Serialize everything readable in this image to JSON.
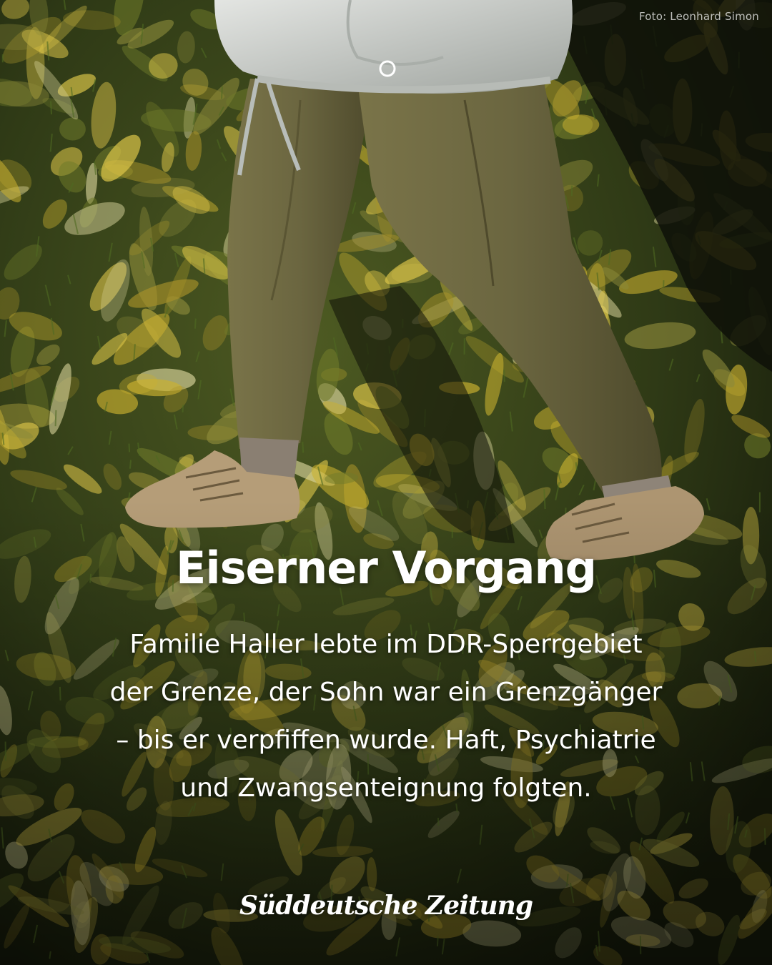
{
  "photo": {
    "subject": "legs-walking-on-autumn-leaves",
    "colors": {
      "grass": "#3a4a1c",
      "leaf_yellow": "#c9b030",
      "leaf_light": "#d8d39a",
      "pants": "#6b6640",
      "jacket": "#c9ccc9",
      "shoes": "#b59d78",
      "shadow": "#0e1108"
    }
  },
  "credit": "Foto: Leonhard Simon",
  "headline": "Eiserner Vorgang",
  "teaser": {
    "lines": [
      "Familie Haller lebte im DDR-Sperrgebiet",
      "der Grenze, der Sohn war ein Grenzgänger",
      "–  bis er verpfiffen wurde. Haft, Psychiatrie",
      "und Zwangsenteignung folgten."
    ]
  },
  "brand": {
    "logo_text": "Süddeutsche Zeitung",
    "color": "#ffffff"
  }
}
